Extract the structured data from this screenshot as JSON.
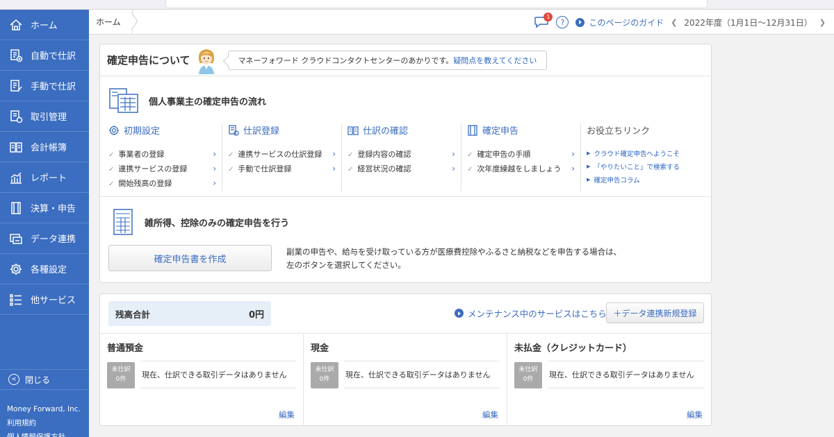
{
  "sidebar": {
    "items": [
      {
        "label": "ホーム",
        "icon": "home-icon"
      },
      {
        "label": "自動で仕訳",
        "icon": "auto-journal-icon"
      },
      {
        "label": "手動で仕訳",
        "icon": "manual-journal-icon"
      },
      {
        "label": "取引管理",
        "icon": "transaction-icon"
      },
      {
        "label": "会計帳簿",
        "icon": "ledger-icon"
      },
      {
        "label": "レポート",
        "icon": "report-icon"
      },
      {
        "label": "決算・申告",
        "icon": "settlement-icon"
      },
      {
        "label": "データ連携",
        "icon": "data-link-icon"
      },
      {
        "label": "各種設定",
        "icon": "gear-icon"
      },
      {
        "label": "他サービス",
        "icon": "list-icon"
      }
    ],
    "close_label": "閉じる",
    "company": "Money Forward, Inc.",
    "terms": "利用規約",
    "privacy": "個人情報保護方針"
  },
  "header": {
    "breadcrumb": "ホーム",
    "notification_count": "1",
    "guide_label": "このページのガイド",
    "fiscal_year": "2022年度（1月1日〜12月31日）"
  },
  "tax_card": {
    "title": "確定申告について",
    "speech_text": "マネーフォワード クラウドコンタクトセンターのあかりです。",
    "speech_link": "疑問点を教えてください",
    "flow_title": "個人事業主の確定申告の流れ",
    "columns": [
      {
        "title": "初期設定",
        "icon": "gear-icon",
        "items": [
          "事業者の登録",
          "連携サービスの登録",
          "開始残高の登録"
        ]
      },
      {
        "title": "仕訳登録",
        "icon": "journal-icon",
        "items": [
          "連携サービスの仕訳登録",
          "手動で仕訳登録"
        ]
      },
      {
        "title": "仕訳の確認",
        "icon": "book-icon",
        "items": [
          "登録内容の確認",
          "経営状況の確認"
        ]
      },
      {
        "title": "確定申告",
        "icon": "tax-return-icon",
        "items": [
          "確定申告の手順",
          "次年度繰越をしましょう"
        ]
      }
    ],
    "links_title": "お役立ちリンク",
    "links": [
      "クラウド確定申告へようこそ",
      "「やりたいこと」で検索する",
      "確定申告コラム"
    ],
    "misc_title": "雑所得、控除のみの確定申告を行う",
    "create_button": "確定申告書を作成",
    "create_desc_1": "副業の申告や、給与を受け取っている方が医療費控除やふるさと納税などを申告する場合は、",
    "create_desc_2": "左のボタンを選択してください。"
  },
  "balance_card": {
    "total_label": "残高合計",
    "total_value": "0円",
    "maintenance_link": "メンテナンス中のサービスはこちら",
    "add_button": "＋データ連携新規登録",
    "accounts": [
      {
        "name": "普通預金",
        "badge_1": "未仕訳",
        "badge_2": "0件",
        "message": "現在、仕訳できる取引データはありません",
        "edit": "編集"
      },
      {
        "name": "現金",
        "badge_1": "未仕訳",
        "badge_2": "0件",
        "message": "現在、仕訳できる取引データはありません",
        "edit": "編集"
      },
      {
        "name": "未払金（クレジットカード）",
        "badge_1": "未仕訳",
        "badge_2": "0件",
        "message": "現在、仕訳できる取引データはありません",
        "edit": "編集"
      }
    ]
  },
  "colors": {
    "sidebar": "#3b6dc0",
    "accent": "#3b6dc0",
    "link": "#2a66c1",
    "badge": "#e04a3c"
  }
}
